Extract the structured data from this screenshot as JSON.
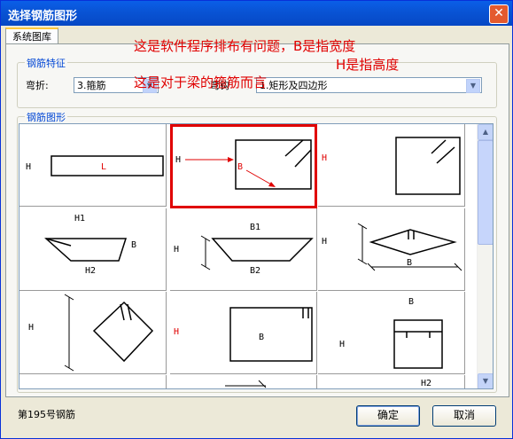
{
  "window": {
    "title": "选择钢筋图形",
    "close_glyph": "✕"
  },
  "tab": {
    "label": "系统图库"
  },
  "feature_group": {
    "title": "钢筋特征",
    "bend_label": "弯折:",
    "bend_value": "3.箍筋",
    "shape_label": "弯钩",
    "shape_value": "1.矩形及四边形"
  },
  "overlay": {
    "line1": "这是软件程序排布有问题，B是指宽度",
    "line2": "H是指高度",
    "line3": "这是对于梁的箍筋而言"
  },
  "shapes_group": {
    "title": "钢筋图形"
  },
  "cells": {
    "c1": {
      "h": "H",
      "l": "L"
    },
    "c2": {
      "h": "H",
      "b": "B",
      "h2": "H"
    },
    "c4": {
      "h1": "H1",
      "b": "B",
      "h2": "H2"
    },
    "c5": {
      "b1": "B1",
      "h": "H",
      "b2": "B2"
    },
    "c6": {
      "h": "H",
      "b": "B"
    },
    "c7": {
      "h": "H"
    },
    "c8": {
      "h": "H",
      "b": "B"
    },
    "c9": {
      "b": "B",
      "h": "H",
      "h2": "H2"
    }
  },
  "status": {
    "text": "第195号钢筋"
  },
  "buttons": {
    "ok": "确定",
    "cancel": "取消"
  }
}
